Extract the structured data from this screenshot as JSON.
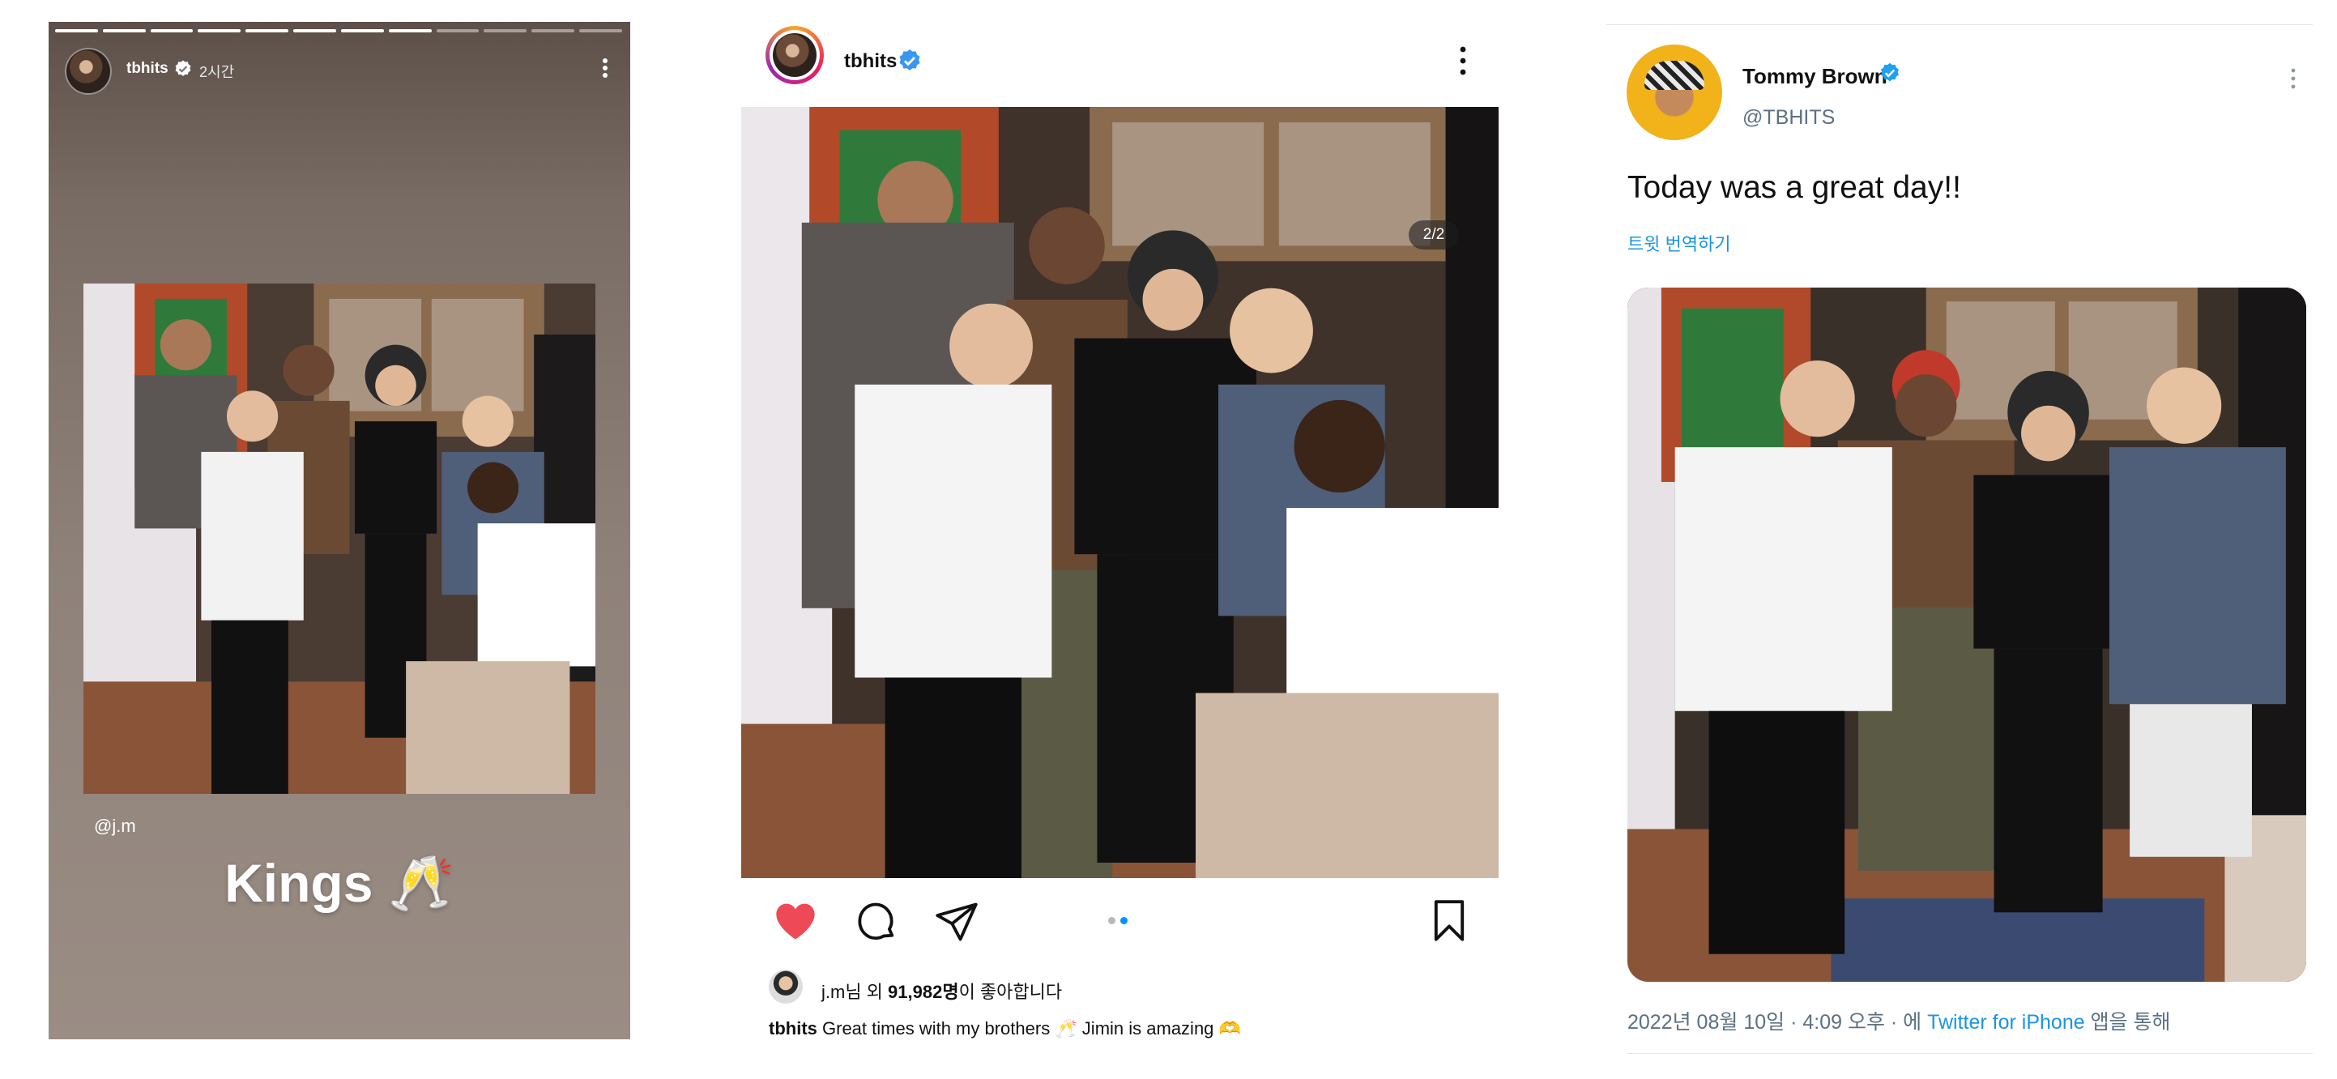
{
  "story": {
    "progress_segments": 12,
    "progress_done": 8,
    "username": "tbhits",
    "time": "2시간",
    "mention": "@j.m",
    "caption": "Kings 🥂"
  },
  "instagram": {
    "username": "tbhits",
    "counter": "2/2",
    "carousel_dots": 2,
    "carousel_active": 2,
    "likes_prefix": "j.m님 외 ",
    "likes_count": "91,982명",
    "likes_suffix": "이 좋아합니다",
    "caption_user": "tbhits",
    "caption_text": " Great times with my brothers 🥂 Jimin is amazing 🫶",
    "liked": true,
    "colors": {
      "like": "#ed4956",
      "dot_active": "#0095f6",
      "verified": "#3897f0"
    }
  },
  "tweet": {
    "name": "Tommy Brown",
    "handle": "@TBHITS",
    "text": "Today was a great day!!",
    "translate": "트윗 번역하기",
    "date": "2022년 08월 10일 · 4:09 오후 · 에 ",
    "source": "Twitter for iPhone",
    "source_suffix": " 앱을 통해",
    "colors": {
      "link": "#1b95e0",
      "verified": "#1da1f2"
    }
  },
  "icons": {
    "verified": "verified-badge-icon",
    "more": "more-vertical-icon",
    "heart": "heart-icon",
    "comment": "comment-icon",
    "share": "share-icon",
    "bookmark": "bookmark-icon",
    "tag": "user-tag-icon"
  }
}
